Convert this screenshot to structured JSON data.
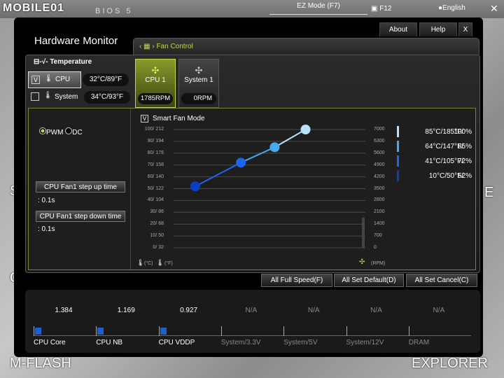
{
  "topbar": {
    "logo": "MOBILE01",
    "bios": "BIOS 5",
    "ez_mode": "EZ Mode (F7)",
    "screenshot": "F12",
    "language": "English",
    "close": "✕"
  },
  "background_tiles": {
    "left_mid": "S",
    "left_low": "O",
    "mflash": "M-FLASH",
    "explorer": "EXPLORER",
    "right_mid": "E"
  },
  "window": {
    "title": "Hardware Monitor",
    "about": "About",
    "help": "Help",
    "close": "X"
  },
  "fan_control_tab": "Fan Control",
  "temperature": {
    "header": "Temperature",
    "rows": [
      {
        "label": "CPU",
        "value": "32°C/89°F",
        "checked": true,
        "check_mark": "V"
      },
      {
        "label": "System",
        "value": "34°C/93°F",
        "checked": false
      }
    ]
  },
  "fans": [
    {
      "label": "CPU 1",
      "rpm": "1785RPM",
      "active": true
    },
    {
      "label": "System 1",
      "rpm": "0RPM",
      "active": false
    }
  ],
  "mode": {
    "pwm": "PWM",
    "dc": "DC",
    "selected": "PWM"
  },
  "step_up": {
    "label": "CPU Fan1 step up time",
    "value": ": 0.1s"
  },
  "step_down": {
    "label": "CPU Fan1 step down time",
    "value": ": 0.1s"
  },
  "smart_fan": {
    "label": "Smart Fan Mode",
    "checked": true,
    "check_mark": "V"
  },
  "chart_data": {
    "type": "line",
    "left_ticks": [
      "100/ 212",
      "90/ 194",
      "80/ 176",
      "70/ 158",
      "60/ 140",
      "50/ 122",
      "40/ 104",
      "30/  86",
      "20/  68",
      "10/  50",
      "0/  32"
    ],
    "right_ticks": [
      "7000",
      "6300",
      "5600",
      "4900",
      "4200",
      "3500",
      "2800",
      "2100",
      "1400",
      "700",
      "0"
    ],
    "left_unit_c": "(°C)",
    "left_unit_f": "(°F)",
    "right_unit": "(RPM)",
    "x_temp_c": [
      10,
      41,
      64,
      85
    ],
    "y_percent": [
      52,
      72,
      85,
      100
    ],
    "point_colors": [
      "#0a3fc4",
      "#1e64ee",
      "#4aa8ee",
      "#b8e2fa"
    ],
    "current_rpm_level": 1785,
    "legend": [
      {
        "temp": "85°C/185°F/",
        "pct": "100%",
        "color": "#b8e2fa"
      },
      {
        "temp": "64°C/147°F/",
        "pct": "85%",
        "color": "#4aa8ee"
      },
      {
        "temp": "41°C/105°F/",
        "pct": "72%",
        "color": "#1e64ee"
      },
      {
        "temp": "10°C/50°F/",
        "pct": "52%",
        "color": "#0a3fc4"
      }
    ]
  },
  "buttons": {
    "full_speed": "All Full Speed(F)",
    "set_default": "All Set Default(D)",
    "set_cancel": "All Set Cancel(C)"
  },
  "voltages": [
    {
      "label": "CPU Core",
      "value": "1.384",
      "active": true
    },
    {
      "label": "CPU NB",
      "value": "1.169",
      "active": true
    },
    {
      "label": "CPU VDDP",
      "value": "0.927",
      "active": true
    },
    {
      "label": "System/3.3V",
      "value": "N/A",
      "active": false
    },
    {
      "label": "System/5V",
      "value": "N/A",
      "active": false
    },
    {
      "label": "System/12V",
      "value": "N/A",
      "active": false
    },
    {
      "label": "DRAM",
      "value": "N/A",
      "active": false
    }
  ],
  "colors": {
    "accent": "#c4d54a",
    "bar": "#1e5fd0"
  }
}
